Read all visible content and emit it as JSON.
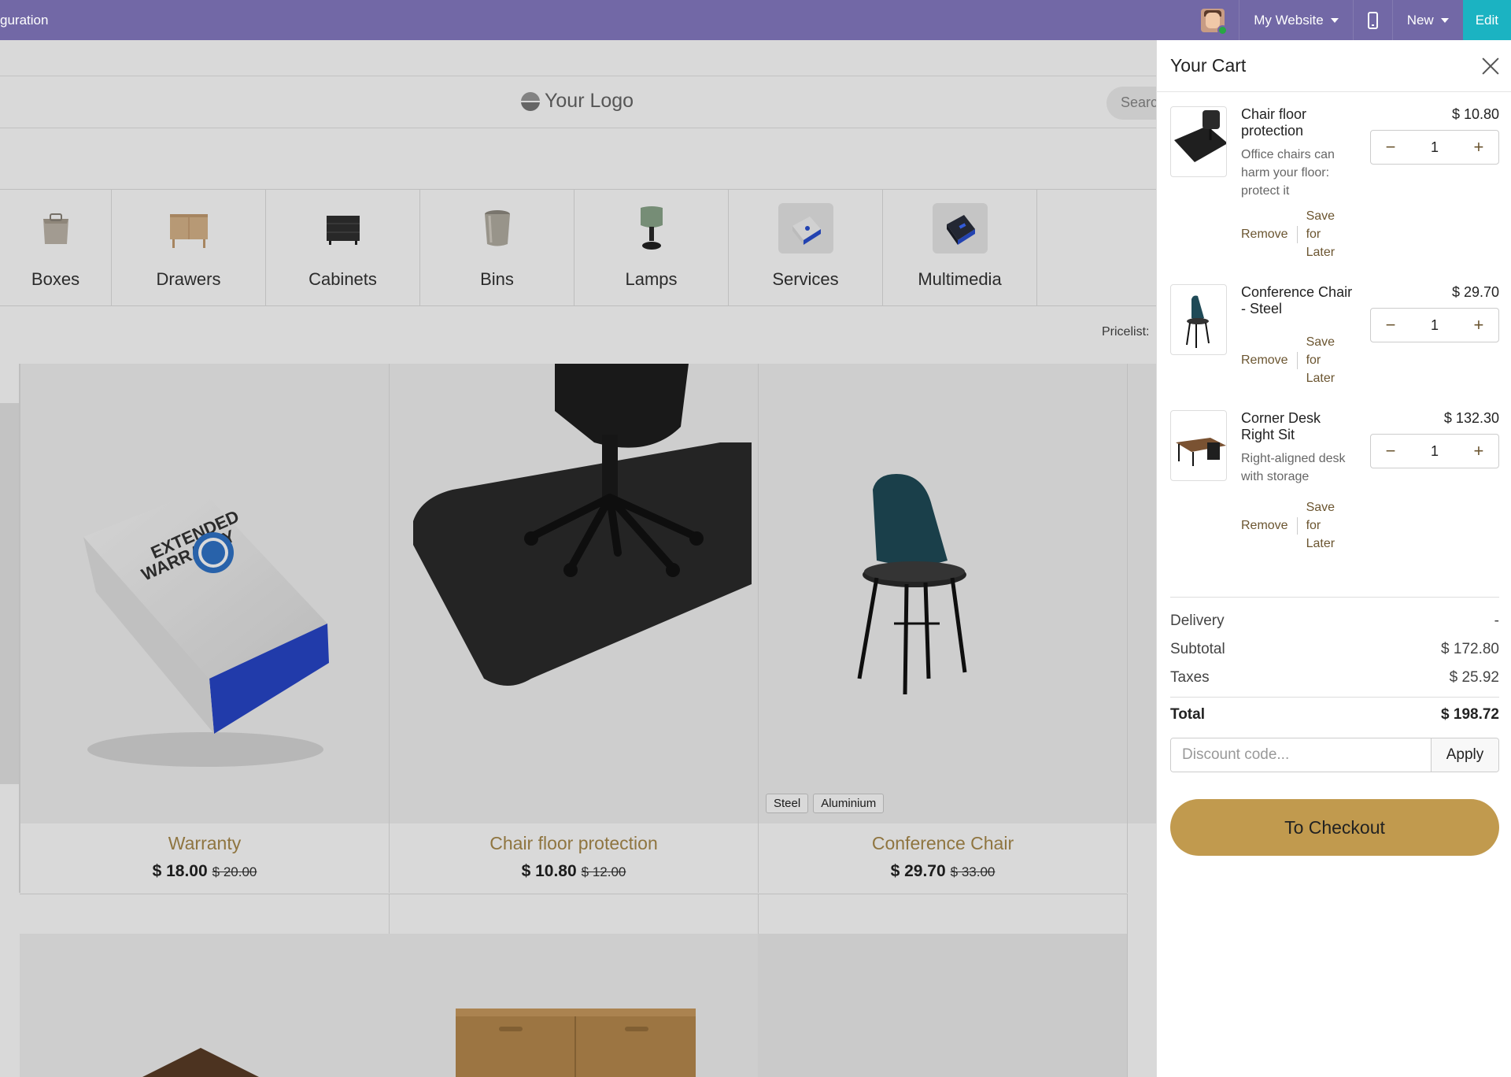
{
  "topbar": {
    "left_text": "guration",
    "website": "My Website",
    "new_label": "New",
    "edit_label": "Edit"
  },
  "header": {
    "logo_text": "Your Logo",
    "search_placeholder": "Searc"
  },
  "categories": [
    {
      "label": "Boxes"
    },
    {
      "label": "Drawers"
    },
    {
      "label": "Cabinets"
    },
    {
      "label": "Bins"
    },
    {
      "label": "Lamps"
    },
    {
      "label": "Services"
    },
    {
      "label": "Multimedia"
    }
  ],
  "pricelist_label": "Pricelist:",
  "products": [
    {
      "title": "Warranty",
      "price": "$ 18.00",
      "old_price": "$ 20.00"
    },
    {
      "title": "Chair floor protection",
      "price": "$ 10.80",
      "old_price": "$ 12.00"
    },
    {
      "title": "Conference Chair",
      "price": "$ 29.70",
      "old_price": "$ 33.00",
      "tags": [
        "Steel",
        "Aluminium"
      ]
    }
  ],
  "cart": {
    "title": "Your Cart",
    "items": [
      {
        "name": "Chair floor protection",
        "description": "Office chairs can harm your floor: protect it",
        "price": "$ 10.80",
        "qty": "1",
        "remove": "Remove",
        "save": "Save for Later"
      },
      {
        "name": "Conference Chair - Steel",
        "description": "",
        "price": "$ 29.70",
        "qty": "1",
        "remove": "Remove",
        "save": "Save for Later"
      },
      {
        "name": "Corner Desk Right Sit",
        "description": "Right-aligned desk with storage",
        "price": "$ 132.30",
        "qty": "1",
        "remove": "Remove",
        "save": "Save for Later"
      }
    ],
    "summary": {
      "delivery_label": "Delivery",
      "delivery_value": "-",
      "subtotal_label": "Subtotal",
      "subtotal_value": "$ 172.80",
      "taxes_label": "Taxes",
      "taxes_value": "$ 25.92",
      "total_label": "Total",
      "total_value": "$ 198.72"
    },
    "discount_placeholder": "Discount code...",
    "apply_label": "Apply",
    "checkout_label": "To Checkout"
  },
  "colors": {
    "topbar": "#7268a6",
    "edit": "#1bb3c2",
    "accent": "#c19a4e",
    "product_title": "#a88a4c"
  }
}
